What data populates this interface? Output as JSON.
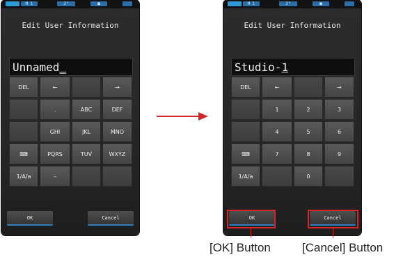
{
  "status_bar": {
    "memory": "M 1",
    "angle": "2°",
    "mode": "■"
  },
  "left_screen": {
    "title": "Edit User Information",
    "input_value": "Unnamed",
    "input_cursor": "_",
    "keys": [
      "DEL",
      "←",
      "",
      "→",
      "",
      ".",
      "ABC",
      "DEF",
      "",
      "GHI",
      "JKL",
      "MNO",
      "⌨",
      "PQRS",
      "TUV",
      "WXYZ",
      "1/A/a",
      "–",
      "",
      ""
    ],
    "ok_label": "OK",
    "cancel_label": "Cancel"
  },
  "right_screen": {
    "title": "Edit User Information",
    "input_value": "Studio-",
    "input_cursor": "1",
    "keys": [
      "DEL",
      "←",
      "",
      "→",
      "",
      "1",
      "2",
      "3",
      "",
      "4",
      "5",
      "6",
      "⌨",
      "7",
      "8",
      "9",
      "1/A/a",
      "",
      "0",
      ""
    ],
    "ok_label": "OK",
    "cancel_label": "Cancel"
  },
  "callouts": {
    "ok": "[OK] Button",
    "cancel": "[Cancel] Button"
  },
  "colors": {
    "accent_red": "#d4262a",
    "button_blue": "#2f7fbf"
  }
}
